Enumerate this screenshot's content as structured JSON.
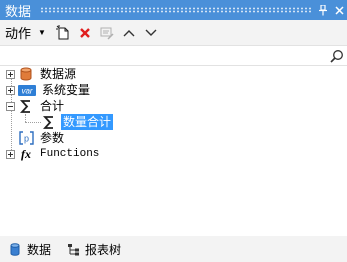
{
  "panel": {
    "title": "数据"
  },
  "toolbar": {
    "action_label": "动作"
  },
  "search": {
    "value": "",
    "placeholder": ""
  },
  "tree": {
    "items": [
      {
        "label": "数据源"
      },
      {
        "label": "系统变量",
        "icon_text": "var"
      },
      {
        "label": "合计"
      },
      {
        "label": "数量合计"
      },
      {
        "label": "参数"
      },
      {
        "label": "Functions",
        "icon_text": "fx"
      }
    ]
  },
  "tabs": [
    {
      "label": "数据"
    },
    {
      "label": "报表树"
    }
  ],
  "colors": {
    "accent": "#4a90d9",
    "selection": "#3399ff",
    "delete": "#e01e1e",
    "datasource": "#e07b3a",
    "var_badge": "#2f7fd6"
  }
}
